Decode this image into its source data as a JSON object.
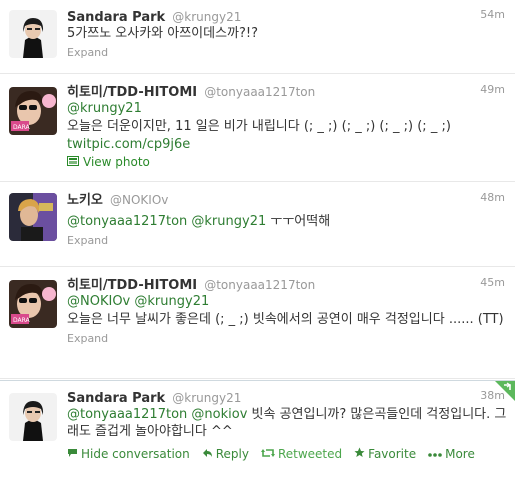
{
  "tweets": [
    {
      "fullname": "Sandara Park",
      "username": "@krungy21",
      "time": "54m",
      "text": "5가쯔노 오사카와 아쯔이데스까?!?",
      "expand": "Expand"
    },
    {
      "fullname": "히토미/TDD-HITOMI",
      "username": "@tonyaaa1217ton",
      "time": "49m",
      "mention": "@krungy21",
      "text": "오늘은 더운이지만, 11 일은 비가 내립니다 (; _ ;) (; _ ;) (; _ ;) (; _ ;)",
      "link": "twitpic.com/cp9j6e",
      "view_photo": "View photo"
    },
    {
      "fullname": "노키오",
      "username": "@NOKIOv",
      "time": "48m",
      "mention1": "@tonyaaa1217ton",
      "mention2": "@krungy21",
      "text": "ㅜㅜ어떡해",
      "expand": "Expand"
    },
    {
      "fullname": "히토미/TDD-HITOMI",
      "username": "@tonyaaa1217ton",
      "time": "45m",
      "mention1": "@NOKIOv",
      "mention2": "@krungy21",
      "text": "오늘은 너무 날씨가 좋은데 (; _ ;) 빗속에서의 공연이 매우 걱정입니다 ...... (TT)",
      "expand": "Expand"
    },
    {
      "fullname": "Sandara Park",
      "username": "@krungy21",
      "time": "38m",
      "mention1": "@tonyaaa1217ton",
      "mention2": "@nokiov",
      "text": "빗속 공연입니까? 많은곡들인데 걱정입니다. 그래도 즐겁게 놀아야합니다 ^^",
      "actions": {
        "hide": "Hide conversation",
        "reply": "Reply",
        "retweeted": "Retweeted",
        "favorite": "Favorite",
        "more": "More"
      }
    }
  ],
  "colors": {
    "link_green": "#2e7d32",
    "retweet_corner": "#5cb85c",
    "muted": "#999999"
  }
}
